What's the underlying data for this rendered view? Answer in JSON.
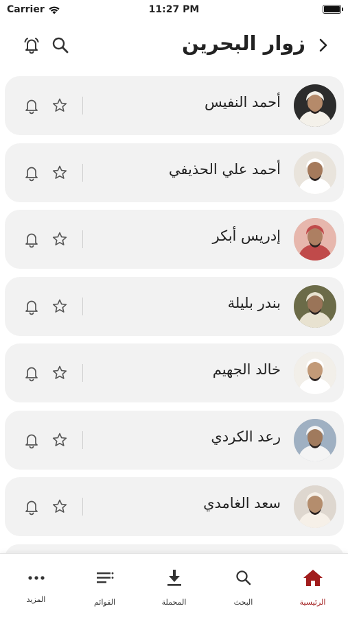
{
  "status_bar": {
    "carrier": "Carrier",
    "time": "11:27 PM"
  },
  "header": {
    "title": "زوار البحرين"
  },
  "reciters": [
    {
      "name": "أحمد النفيس"
    },
    {
      "name": "أحمد علي الحذيفي"
    },
    {
      "name": "إدريس أبكر"
    },
    {
      "name": "بندر بليلة"
    },
    {
      "name": "خالد الجهيم"
    },
    {
      "name": "رعد الكردي"
    },
    {
      "name": "سعد الغامدي"
    }
  ],
  "tabs": [
    {
      "label": "المزيد",
      "icon": "more-icon"
    },
    {
      "label": "القوائم",
      "icon": "playlist-icon"
    },
    {
      "label": "المحملة",
      "icon": "download-icon"
    },
    {
      "label": "البحث",
      "icon": "search-icon"
    },
    {
      "label": "الرئيسية",
      "icon": "home-icon",
      "active": true
    }
  ],
  "colors": {
    "accent": "#a11c1c",
    "card_bg": "#f2f2f2",
    "icon": "#555555"
  }
}
